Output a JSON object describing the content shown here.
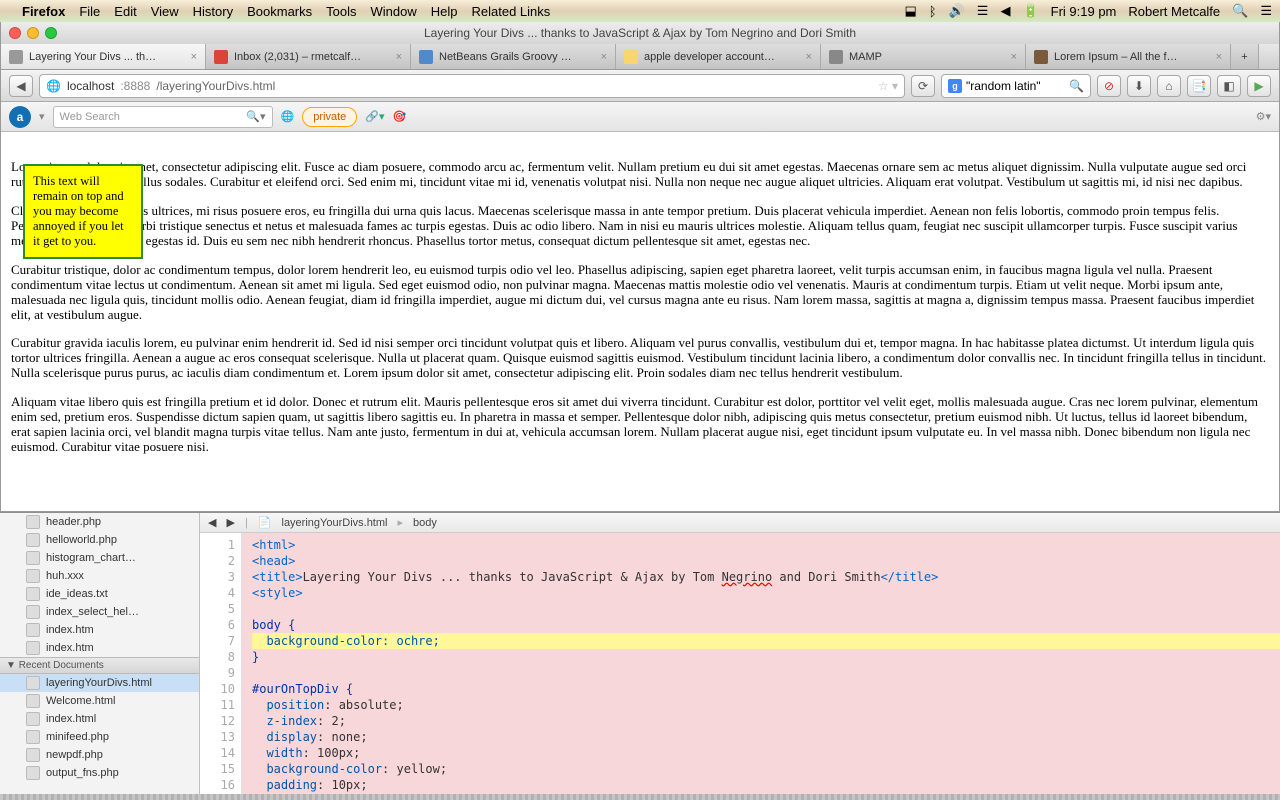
{
  "menubar": {
    "app": "Firefox",
    "items": [
      "File",
      "Edit",
      "View",
      "History",
      "Bookmarks",
      "Tools",
      "Window",
      "Help",
      "Related Links"
    ],
    "clock": "Fri 9:19 pm",
    "user": "Robert Metcalfe"
  },
  "window": {
    "title": "Layering Your Divs ... thanks to JavaScript & Ajax by Tom Negrino and Dori Smith"
  },
  "tabs": [
    {
      "label": "Layering Your Divs ... th…",
      "active": true
    },
    {
      "label": "Inbox (2,031) – rmetcalf…"
    },
    {
      "label": "NetBeans Grails Groovy …"
    },
    {
      "label": "apple developer account…"
    },
    {
      "label": "MAMP"
    },
    {
      "label": "Lorem Ipsum – All the f…"
    }
  ],
  "url": {
    "host": "localhost",
    "port": ":8888",
    "path": "/layeringYourDivs.html"
  },
  "search": {
    "placeholder": "\"random latin\""
  },
  "toolbar2": {
    "webSearchPlaceholder": "Web Search",
    "privateLabel": "private"
  },
  "sticky": "This text will remain on top and you may become annoyed if you let it get to you.",
  "paragraphs": [
    "Lorem ipsum dolor sit amet, consectetur adipiscing elit. Fusce ac diam posuere, commodo arcu ac, fermentum velit. Nullam pretium eu dui sit amet egestas. Maecenas ornare sem ac metus aliquet dignissim. Nulla vulputate augue sed orci rutrum, sodales dictum tellus sodales. Curabitur et eleifend orci. Sed enim mi, tincidunt vitae mi id, venenatis volutpat nisi. Nulla non neque nec augue aliquet ultricies. Aliquam erat volutpat. Vestibulum ut sagittis mi, id nisi nec dapibus.",
    "Class aptent taciti a mollis ultrices, mi risus posuere eros, eu fringilla dui urna quis lacus. Maecenas scelerisque massa in ante tempor pretium. Duis placerat vehicula imperdiet. Aenean non felis lobortis, commodo proin tempus felis. Pellentesque habitant morbi tristique senectus et netus et malesuada fames ac turpis egestas. Duis ac odio libero. Nam in nisi eu mauris ultrices molestie. Aliquam tellus quam, feugiat nec suscipit ullamcorper turpis. Fusce suscipit varius metus, vel aliquam turpis egestas id. Duis eu sem nec nibh hendrerit rhoncus. Phasellus tortor metus, consequat dictum pellentesque sit amet, egestas nec.",
    "Curabitur tristique, dolor ac condimentum tempus, dolor lorem hendrerit leo, eu euismod turpis odio vel leo. Phasellus adipiscing, sapien eget pharetra laoreet, velit turpis accumsan enim, in faucibus magna ligula vel nulla. Praesent condimentum vitae lectus ut condimentum. Aenean sit amet mi ligula. Sed eget euismod odio, non pulvinar magna. Maecenas mattis molestie odio vel venenatis. Mauris at condimentum turpis. Etiam ut velit neque. Morbi ipsum ante, malesuada nec ligula quis, tincidunt mollis odio. Aenean feugiat, diam id fringilla imperdiet, augue mi dictum dui, vel cursus magna ante eu risus. Nam lorem massa, sagittis at magna a, dignissim tempus massa. Praesent faucibus imperdiet elit, at vestibulum augue.",
    "Curabitur gravida iaculis lorem, eu pulvinar enim hendrerit id. Sed id nisi semper orci tincidunt volutpat quis et libero. Aliquam vel purus convallis, vestibulum dui et, tempor magna. In hac habitasse platea dictumst. Ut interdum ligula quis tortor ultrices fringilla. Aenean a augue ac eros consequat scelerisque. Nulla ut placerat quam. Quisque euismod sagittis euismod. Vestibulum tincidunt lacinia libero, a condimentum dolor convallis nec. In tincidunt fringilla tellus in tincidunt. Nulla scelerisque purus purus, ac iaculis diam condimentum et. Lorem ipsum dolor sit amet, consectetur adipiscing elit. Proin sodales diam nec tellus hendrerit vestibulum.",
    "Aliquam vitae libero quis est fringilla pretium et id dolor. Donec et rutrum elit. Mauris pellentesque eros sit amet dui viverra tincidunt. Curabitur est dolor, porttitor vel velit eget, mollis malesuada augue. Cras nec lorem pulvinar, elementum enim sed, pretium eros. Suspendisse dictum sapien quam, ut sagittis libero sagittis eu. In pharetra in massa et semper. Pellentesque dolor nibh, adipiscing quis metus consectetur, pretium euismod nibh. Ut luctus, tellus id laoreet bibendum, erat sapien lacinia orci, vel blandit magna turpis vitae tellus. Nam ante justo, fermentum in dui at, vehicula accumsan lorem. Nullam placerat augue nisi, eget tincidunt ipsum vulputate eu. In vel massa nibh. Donec bibendum non ligula nec euismod. Curabitur vitae posuere nisi."
  ],
  "sidebar": {
    "files1": [
      "header.php",
      "helloworld.php",
      "histogram_chart…",
      "huh.xxx",
      "ide_ideas.txt",
      "index_select_hel…",
      "index.htm",
      "index.htm"
    ],
    "section": "Recent Documents",
    "files2": [
      "layeringYourDivs.html",
      "Welcome.html",
      "index.html",
      "minifeed.php",
      "newpdf.php",
      "output_fns.php"
    ]
  },
  "crumbs": {
    "file": "layeringYourDivs.html",
    "scope": "body"
  },
  "code": {
    "lineNumbers": "1\n2\n3\n4\n5\n6\n7\n8\n9\n10\n11\n12\n13\n14\n15\n16",
    "l1": "<html>",
    "l2": "<head>",
    "l3a": "<title>",
    "l3b": "Layering Your Divs ... thanks to JavaScript & Ajax by Tom ",
    "l3u": "Negrino",
    "l3c": " and Dori Smith",
    "l3d": "</title>",
    "l4": "<style>",
    "l5": "",
    "l6": "body {",
    "l7": "  background-color: ochre;",
    "l8": "}",
    "l9": "",
    "l10": "#ourOnTopDiv {",
    "l11a": "  position",
    "l11b": ": absolute;",
    "l12a": "  z-index",
    "l12b": ": 2;",
    "l13a": "  display",
    "l13b": ": none;",
    "l14a": "  width",
    "l14b": ": 100px;",
    "l15a": "  background-color",
    "l15b": ": yellow;",
    "l16a": "  padding",
    "l16b": ": 10px;"
  }
}
